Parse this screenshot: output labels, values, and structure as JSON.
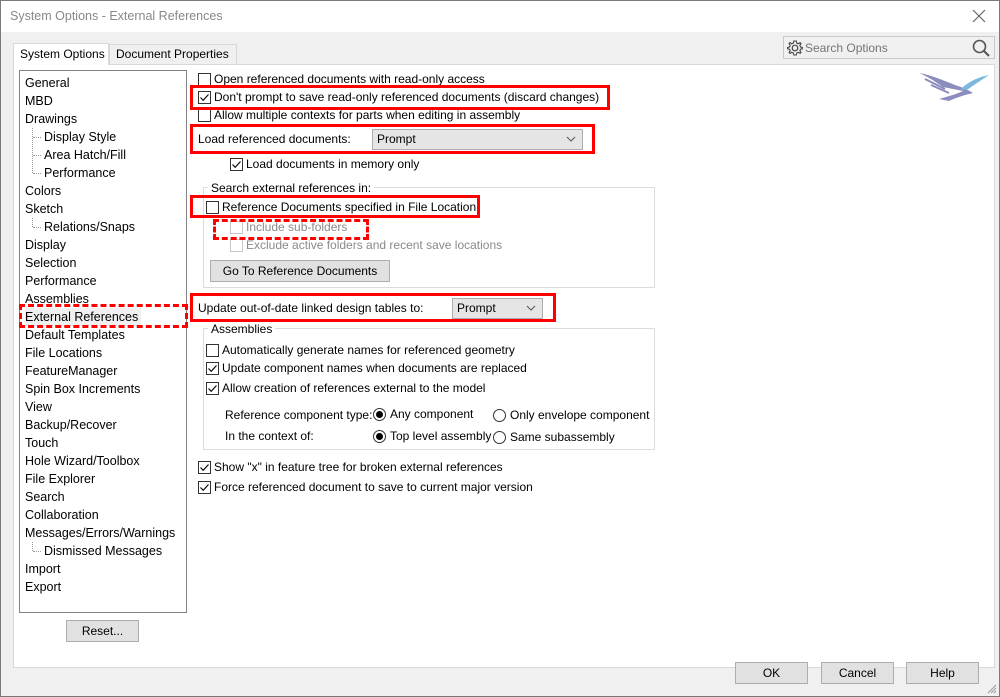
{
  "window": {
    "title": "System Options - External References",
    "close_icon": "close-icon"
  },
  "tabs": [
    {
      "label": "System Options",
      "active": true
    },
    {
      "label": "Document Properties",
      "active": false
    }
  ],
  "search": {
    "placeholder": "Search Options",
    "value": "",
    "left_icon": "gear-icon",
    "right_icon": "magnifier-icon"
  },
  "sidebar": {
    "items": [
      {
        "label": "General",
        "level": 0
      },
      {
        "label": "MBD",
        "level": 0
      },
      {
        "label": "Drawings",
        "level": 0
      },
      {
        "label": "Display Style",
        "level": 1
      },
      {
        "label": "Area Hatch/Fill",
        "level": 1
      },
      {
        "label": "Performance",
        "level": 1
      },
      {
        "label": "Colors",
        "level": 0
      },
      {
        "label": "Sketch",
        "level": 0
      },
      {
        "label": "Relations/Snaps",
        "level": 1
      },
      {
        "label": "Display",
        "level": 0
      },
      {
        "label": "Selection",
        "level": 0
      },
      {
        "label": "Performance",
        "level": 0
      },
      {
        "label": "Assemblies",
        "level": 0
      },
      {
        "label": "External References",
        "level": 0,
        "selected": true
      },
      {
        "label": "Default Templates",
        "level": 0
      },
      {
        "label": "File Locations",
        "level": 0
      },
      {
        "label": "FeatureManager",
        "level": 0
      },
      {
        "label": "Spin Box Increments",
        "level": 0
      },
      {
        "label": "View",
        "level": 0
      },
      {
        "label": "Backup/Recover",
        "level": 0
      },
      {
        "label": "Touch",
        "level": 0
      },
      {
        "label": "Hole Wizard/Toolbox",
        "level": 0
      },
      {
        "label": "File Explorer",
        "level": 0
      },
      {
        "label": "Search",
        "level": 0
      },
      {
        "label": "Collaboration",
        "level": 0
      },
      {
        "label": "Messages/Errors/Warnings",
        "level": 0
      },
      {
        "label": "Dismissed Messages",
        "level": 1
      },
      {
        "label": "Import",
        "level": 0
      },
      {
        "label": "Export",
        "level": 0
      }
    ],
    "reset_label": "Reset..."
  },
  "options": {
    "open_readonly": {
      "label": "Open referenced documents with read-only access",
      "checked": false
    },
    "dont_prompt_save": {
      "label": "Don't prompt to save read-only referenced documents (discard changes)",
      "checked": true
    },
    "allow_multiple_contexts": {
      "label": "Allow multiple contexts for parts when editing in assembly",
      "checked": false
    },
    "load_referenced": {
      "label": "Load referenced documents:",
      "value": "Prompt"
    },
    "load_in_memory": {
      "label": "Load documents in memory only",
      "checked": true
    },
    "search_group": {
      "title": "Search external references in:",
      "reference_docs": {
        "label": "Reference Documents specified in File Location",
        "checked": false
      },
      "include_subfolders": {
        "label": "Include sub-folders",
        "checked": false,
        "disabled": true
      },
      "exclude_active": {
        "label": "Exclude active folders and recent save locations",
        "checked": false,
        "disabled": true
      },
      "go_to_button": "Go To Reference Documents"
    },
    "update_design_tables": {
      "label": "Update out-of-date linked design tables to:",
      "value": "Prompt"
    },
    "assemblies_group": {
      "title": "Assemblies",
      "auto_names": {
        "label": "Automatically generate names for referenced geometry",
        "checked": false
      },
      "update_component_names": {
        "label": "Update component names when documents are replaced",
        "checked": true
      },
      "allow_external_refs": {
        "label": "Allow creation of references external to the model",
        "checked": true
      },
      "ref_component_type": {
        "label": "Reference component type:",
        "options": [
          "Any component",
          "Only envelope component"
        ],
        "selected": "Any component"
      },
      "in_context_of": {
        "label": "In the context of:",
        "options": [
          "Top level assembly",
          "Same subassembly"
        ],
        "selected": "Top level assembly"
      }
    },
    "show_x": {
      "label": "Show \"x\" in feature tree for broken external references",
      "checked": true
    },
    "force_save_major": {
      "label": "Force referenced document to save to current major version",
      "checked": true
    }
  },
  "footer": {
    "ok": "OK",
    "cancel": "Cancel",
    "help": "Help"
  },
  "colors": {
    "highlight": "#ff0000",
    "logo_purple": "#8c8cbe",
    "logo_blue": "#7ab8e0"
  }
}
